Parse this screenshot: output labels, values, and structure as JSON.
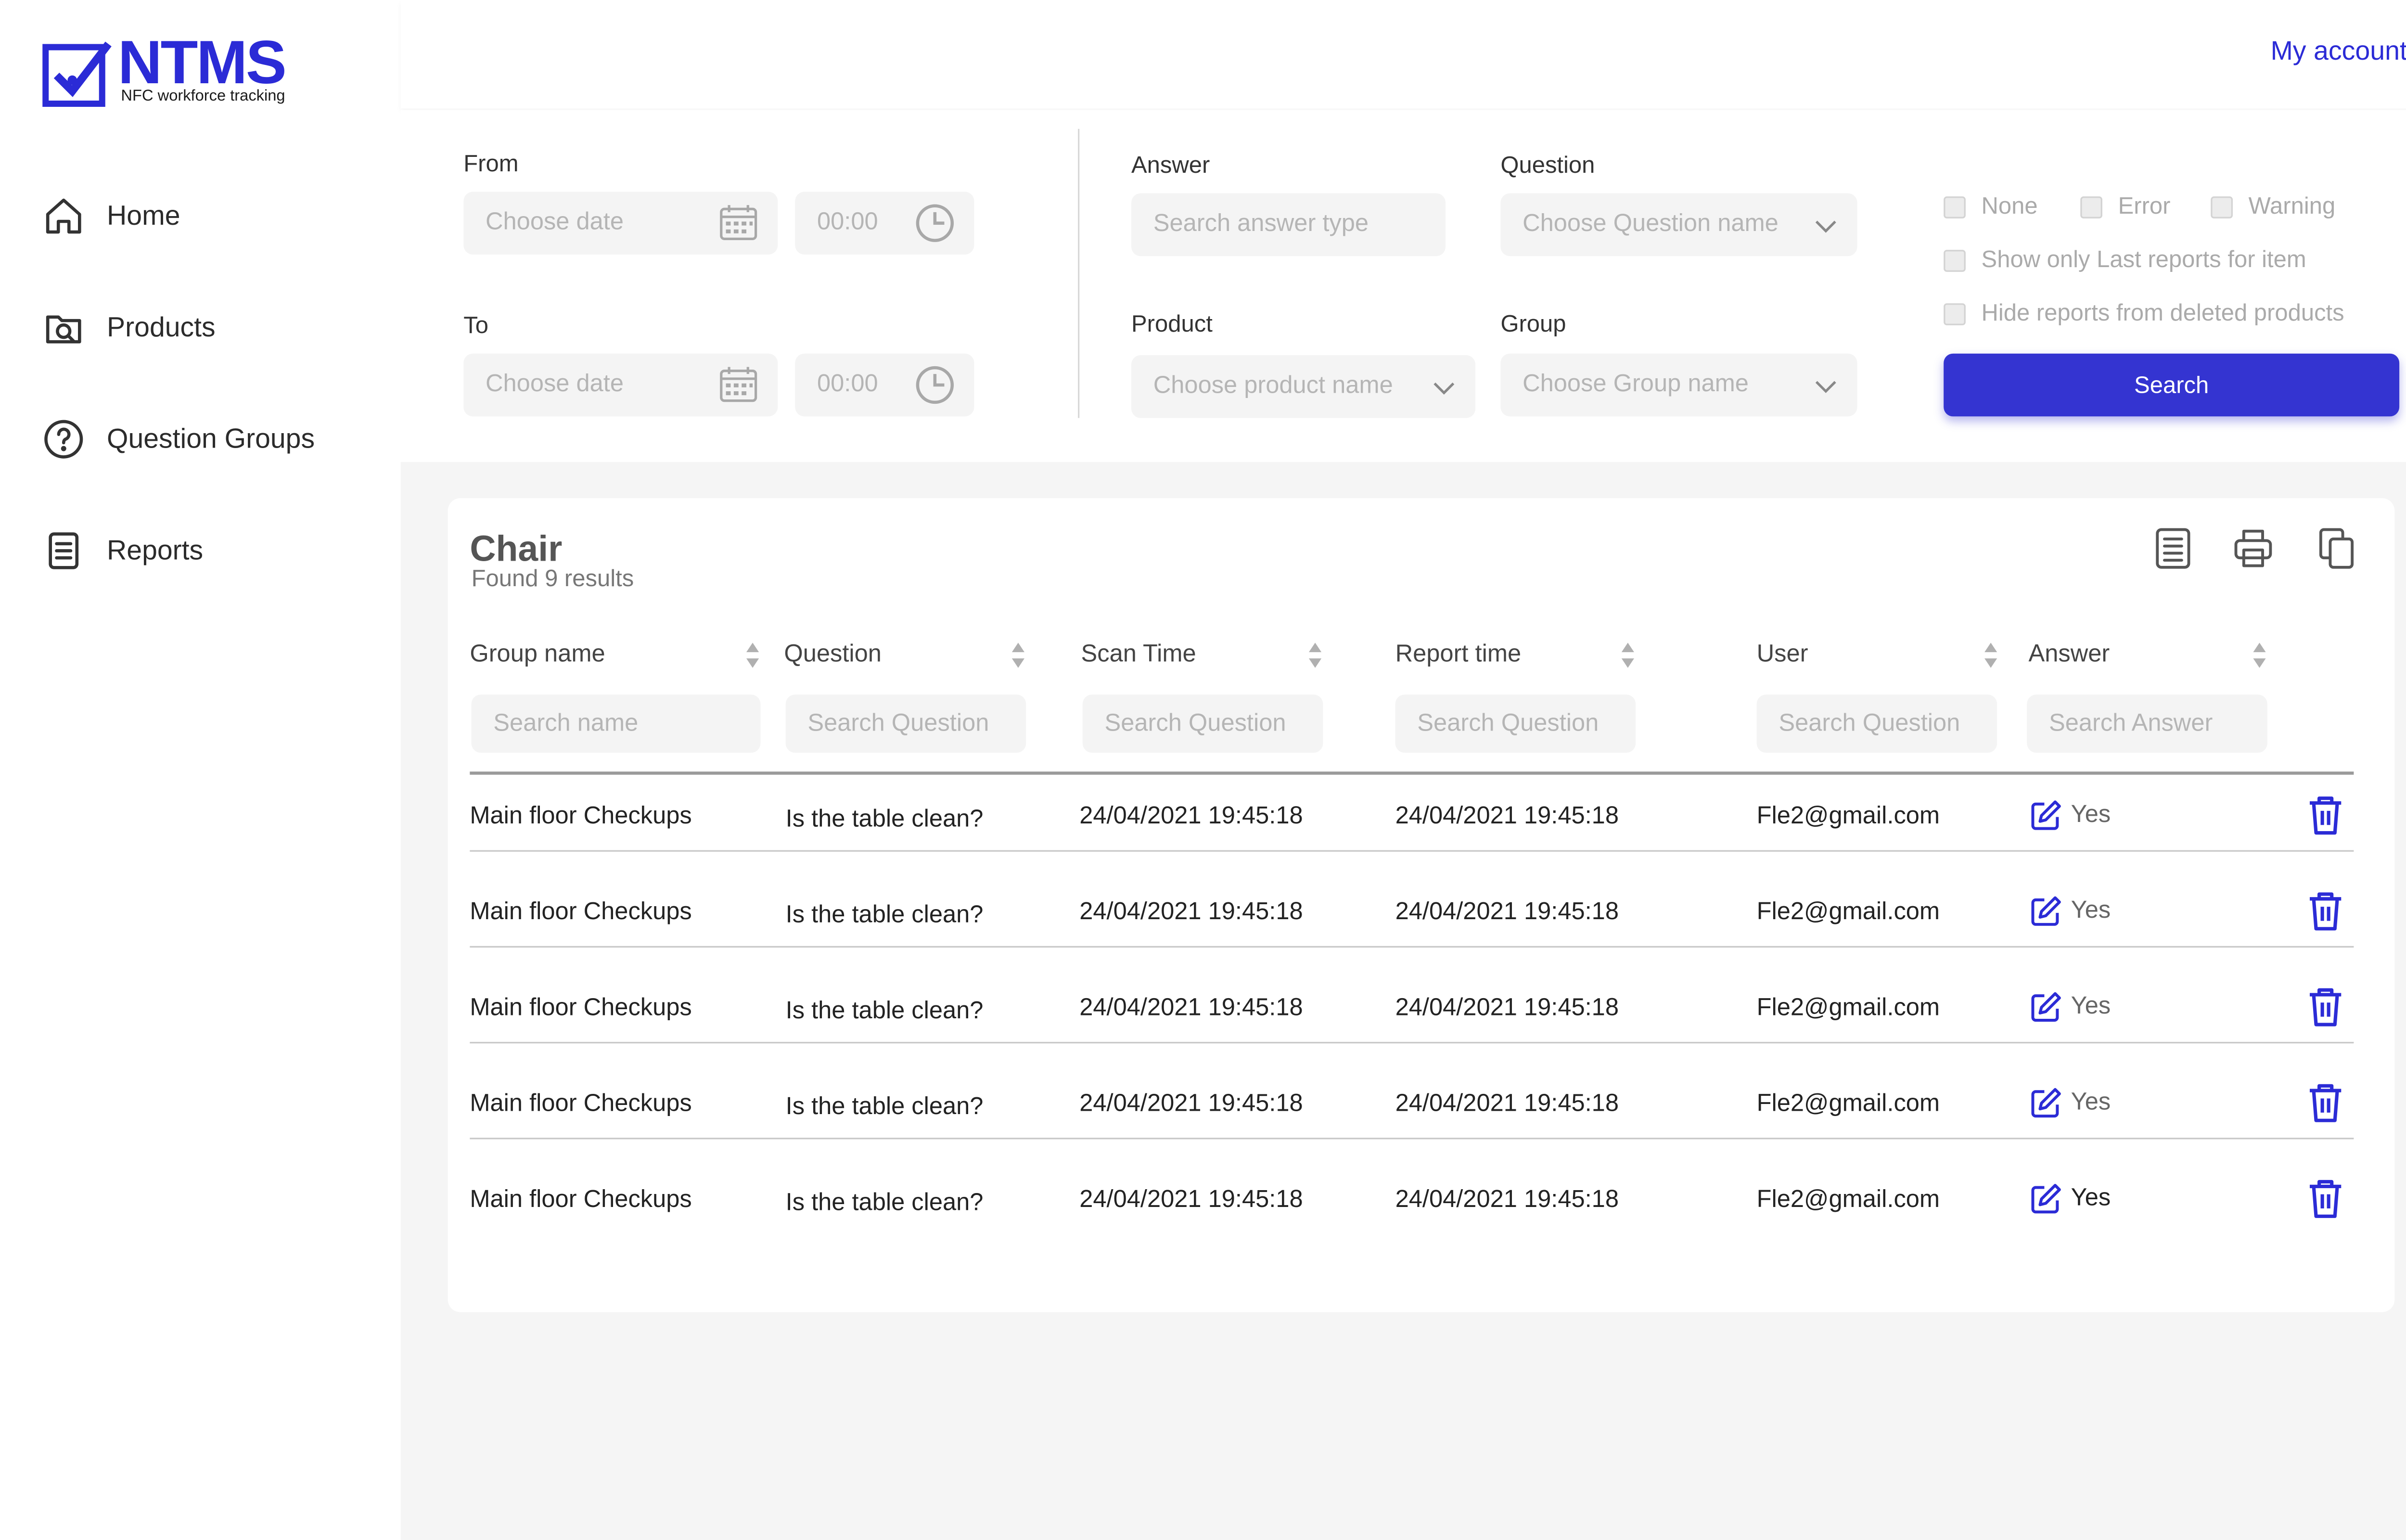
{
  "brand": {
    "name": "NTMS",
    "tagline": "NFC workforce tracking",
    "accent": "#2b2bd6"
  },
  "header": {
    "account_label": "My account"
  },
  "sidebar": {
    "items": [
      {
        "label": "Home",
        "icon": "home-icon"
      },
      {
        "label": "Products",
        "icon": "product-search-icon"
      },
      {
        "label": "Question Groups",
        "icon": "question-circle-icon"
      },
      {
        "label": "Reports",
        "icon": "report-document-icon"
      }
    ]
  },
  "filters": {
    "from_label": "From",
    "to_label": "To",
    "date_placeholder": "Choose date",
    "time_placeholder": "00:00",
    "answer_label": "Answer",
    "answer_placeholder": "Search answer type",
    "question_label": "Question",
    "question_placeholder": "Choose Question name",
    "product_label": "Product",
    "product_placeholder": "Choose product name",
    "group_label": "Group",
    "group_placeholder": "Choose Group name",
    "checkboxes": {
      "none": "None",
      "error": "Error",
      "warning": "Warning",
      "last_reports": "Show only Last reports for item",
      "hide_deleted": "Hide reports from deleted products"
    },
    "search_button": "Search"
  },
  "results": {
    "title": "Chair",
    "subtitle": "Found 9 results",
    "columns": {
      "group": "Group name",
      "question": "Question",
      "scan_time": "Scan Time",
      "report_time": "Report time",
      "user": "User",
      "answer": "Answer"
    },
    "column_search": {
      "group": "Search name",
      "question": "Search Question",
      "scan_time": "Search Question",
      "report_time": "Search Question",
      "user": "Search Question",
      "answer": "Search Answer"
    },
    "rows": [
      {
        "group": "Main floor Checkups",
        "question": "Is the table clean?",
        "scan_time": "24/04/2021 19:45:18",
        "report_time": "24/04/2021 19:45:18",
        "user": "Fle2@gmail.com",
        "answer": "Yes"
      },
      {
        "group": "Main floor Checkups",
        "question": "Is the table clean?",
        "scan_time": "24/04/2021 19:45:18",
        "report_time": "24/04/2021 19:45:18",
        "user": "Fle2@gmail.com",
        "answer": "Yes"
      },
      {
        "group": "Main floor Checkups",
        "question": "Is the table clean?",
        "scan_time": "24/04/2021 19:45:18",
        "report_time": "24/04/2021 19:45:18",
        "user": "Fle2@gmail.com",
        "answer": "Yes"
      },
      {
        "group": "Main floor Checkups",
        "question": "Is the table clean?",
        "scan_time": "24/04/2021 19:45:18",
        "report_time": "24/04/2021 19:45:18",
        "user": "Fle2@gmail.com",
        "answer": "Yes"
      },
      {
        "group": "Main floor Checkups",
        "question": "Is the table clean?",
        "scan_time": "24/04/2021 19:45:18",
        "report_time": "24/04/2021 19:45:18",
        "user": "Fle2@gmail.com",
        "answer": "Yes"
      }
    ]
  }
}
